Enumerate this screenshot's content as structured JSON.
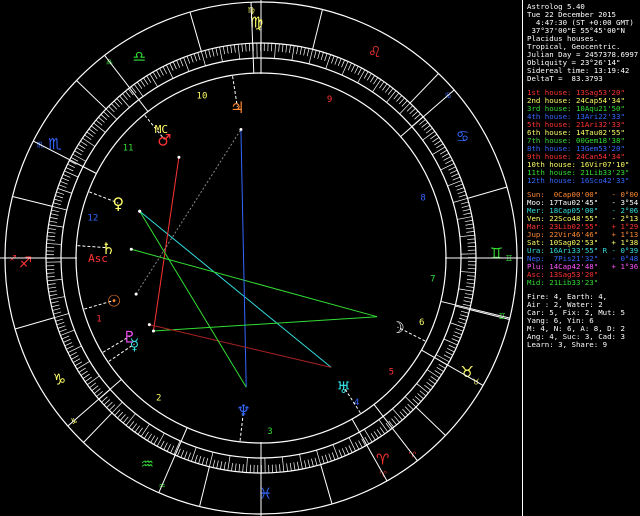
{
  "colors": {
    "white": "#ffffff",
    "red": "#ff3333",
    "green": "#33dd33",
    "blue": "#3366ff",
    "yellow": "#ffff66",
    "cyan": "#33dddd",
    "magenta": "#ff55ff",
    "gray": "#888888",
    "darkred": "#aa2222",
    "orange": "#ff8833"
  },
  "info": [
    {
      "text": "Astrolog 5.40",
      "color": "white"
    },
    {
      "text": "Tue 22 December 2015",
      "color": "white"
    },
    {
      "text": "  4:47:30 (ST +0:00 GMT)",
      "color": "white"
    },
    {
      "text": " 37°37'00\"E 55°45'00\"N",
      "color": "white"
    },
    {
      "text": "Placidus houses.",
      "color": "white"
    },
    {
      "text": "Tropical, Geocentric.",
      "color": "white"
    },
    {
      "text": "Julian Day = 2457378.6997",
      "color": "white"
    },
    {
      "text": "Obliquity = 23°26'14\"",
      "color": "white"
    },
    {
      "text": "Sidereal time: 13:19:42",
      "color": "white"
    },
    {
      "text": "DeltaT =  83.3793",
      "color": "white"
    }
  ],
  "houses": [
    {
      "text": "1st house: 13Sag53'20\"",
      "color": "red"
    },
    {
      "text": "2nd house: 24Cap54'34\"",
      "color": "yellow"
    },
    {
      "text": "3rd house: 10Aqu21'50\"",
      "color": "green"
    },
    {
      "text": "4th house: 13Ari22'33\"",
      "color": "blue"
    },
    {
      "text": "5th house: 21Ari32'33\"",
      "color": "red"
    },
    {
      "text": "6th house: 14Tau02'55\"",
      "color": "yellow"
    },
    {
      "text": "7th house: 00Gem18'38\"",
      "color": "green"
    },
    {
      "text": "8th house: 13Gem53'20\"",
      "color": "blue"
    },
    {
      "text": "9th house: 24Can54'34\"",
      "color": "red"
    },
    {
      "text": "10th house: 16Vir07'10\"",
      "color": "yellow"
    },
    {
      "text": "11th house: 21Lib33'23\"",
      "color": "green"
    },
    {
      "text": "12th house: 16Sco42'33\"",
      "color": "blue"
    }
  ],
  "planets": [
    {
      "text": "Sun:  0Cap00'00\"   - 0°00'",
      "color": "orange"
    },
    {
      "text": "Moo: 17Tau02'45\"   - 3°54'",
      "color": "white"
    },
    {
      "text": "Mer: 18Cap05'00\"   - 2°06'",
      "color": "cyan"
    },
    {
      "text": "Ven: 22Sco48'55\"   - 2°13'",
      "color": "yellow"
    },
    {
      "text": "Mar: 23Lib02'55\"   + 1°29'",
      "color": "red"
    },
    {
      "text": "Jup: 22Vir46'46\"   + 1°13'",
      "color": "orange"
    },
    {
      "text": "Sat: 10Sag02'53\"   + 1°38'",
      "color": "yellow"
    },
    {
      "text": "Ura: 16Ari33'55\" R - 0°39'",
      "color": "cyan"
    },
    {
      "text": "Nep:  7Pis21'32\"   - 0°48'",
      "color": "blue"
    },
    {
      "text": "Plu: 14Cap42'48\"   + 1°36'",
      "color": "magenta"
    },
    {
      "text": "Asc: 13Sag53'20\"",
      "color": "red"
    },
    {
      "text": "Mid: 21Lib33'23\"",
      "color": "green"
    }
  ],
  "stats": [
    {
      "text": "Fire: 4, Earth: 4,",
      "color": "white"
    },
    {
      "text": "Air : 2, Water: 2",
      "color": "white"
    },
    {
      "text": "Car: 5, Fix: 2, Mut: 5",
      "color": "white"
    },
    {
      "text": "Yang: 6, Yin: 6",
      "color": "white"
    },
    {
      "text": "M: 4, N: 6, A: 8, D: 2",
      "color": "white"
    },
    {
      "text": "Ang: 4, Suc: 3, Cad: 3",
      "color": "white"
    },
    {
      "text": "Learn: 3, Share: 9",
      "color": "white"
    }
  ],
  "signs": [
    {
      "glyph": "♈",
      "name": "aries-sign",
      "color": "red"
    },
    {
      "glyph": "♉",
      "name": "taurus-sign",
      "color": "yellow"
    },
    {
      "glyph": "♊",
      "name": "gemini-sign",
      "color": "green"
    },
    {
      "glyph": "♋",
      "name": "cancer-sign",
      "color": "blue"
    },
    {
      "glyph": "♌",
      "name": "leo-sign",
      "color": "red"
    },
    {
      "glyph": "♍",
      "name": "virgo-sign",
      "color": "yellow"
    },
    {
      "glyph": "♎",
      "name": "libra-sign",
      "color": "green"
    },
    {
      "glyph": "♏",
      "name": "scorpio-sign",
      "color": "blue"
    },
    {
      "glyph": "♐",
      "name": "sagittarius-sign",
      "color": "red"
    },
    {
      "glyph": "♑",
      "name": "capricorn-sign",
      "color": "yellow"
    },
    {
      "glyph": "♒",
      "name": "aquarius-sign",
      "color": "green"
    },
    {
      "glyph": "♓",
      "name": "pisces-sign",
      "color": "blue"
    }
  ],
  "house_numbers": [
    "1",
    "2",
    "3",
    "4",
    "5",
    "6",
    "7",
    "8",
    "9",
    "10",
    "11",
    "12"
  ],
  "house_cusps_deg": [
    253.89,
    294.91,
    320.36,
    13.37,
    21.54,
    44.05,
    60.31,
    73.89,
    114.91,
    166.12,
    201.56,
    226.71
  ],
  "asc_deg": 253.89,
  "planet_glyphs": [
    {
      "glyph": "☉",
      "name": "sun",
      "lon": 270.0,
      "color": "orange"
    },
    {
      "glyph": "☽",
      "name": "moon",
      "lon": 47.05,
      "color": "white"
    },
    {
      "glyph": "☿",
      "name": "mercury",
      "lon": 288.08,
      "color": "cyan"
    },
    {
      "glyph": "♀",
      "name": "venus",
      "lon": 232.82,
      "color": "yellow"
    },
    {
      "glyph": "♂",
      "name": "mars",
      "lon": 203.05,
      "color": "red"
    },
    {
      "glyph": "♃",
      "name": "jupiter",
      "lon": 172.78,
      "color": "orange"
    },
    {
      "glyph": "♄",
      "name": "saturn",
      "lon": 250.05,
      "color": "yellow"
    },
    {
      "glyph": "♅",
      "name": "uranus",
      "lon": 16.57,
      "color": "cyan"
    },
    {
      "glyph": "♆",
      "name": "neptune",
      "lon": 337.36,
      "color": "blue"
    },
    {
      "glyph": "♇",
      "name": "pluto",
      "lon": 284.71,
      "color": "magenta"
    }
  ],
  "angles": [
    {
      "label": "Asc",
      "name": "ascendant",
      "lon": 253.89,
      "color": "red"
    },
    {
      "label": "MC",
      "name": "midheaven",
      "lon": 201.56,
      "color": "yellow"
    }
  ],
  "aspect_lines": [
    {
      "a": "venus",
      "b": "uranus",
      "color": "cyan"
    },
    {
      "a": "mars",
      "b": "mercury",
      "color": "red"
    },
    {
      "a": "saturn",
      "b": "moon",
      "color": "green"
    },
    {
      "a": "jupiter",
      "b": "neptune",
      "color": "blue"
    },
    {
      "a": "mercury",
      "b": "moon",
      "color": "green"
    },
    {
      "a": "sun",
      "b": "jupiter",
      "color": "gray"
    },
    {
      "a": "pluto",
      "b": "uranus",
      "color": "darkred"
    },
    {
      "a": "venus",
      "b": "neptune",
      "color": "green"
    }
  ]
}
